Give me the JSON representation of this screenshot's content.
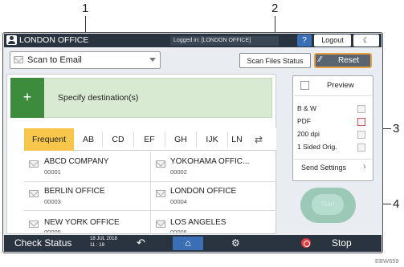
{
  "callouts": [
    "1",
    "2",
    "3",
    "4"
  ],
  "header": {
    "title": "LONDON OFFICE",
    "logged_in": "Logged in: [LONDON OFFICE]",
    "help": "?",
    "logout": "Logout",
    "moon_icon": "moon-icon"
  },
  "function_select": {
    "value": "Scan to Email",
    "icon": "envelope-icon"
  },
  "scan_files_status": "Scan Files Status",
  "reset": "Reset",
  "destination": {
    "plus": "+",
    "label": "Specify destination(s)"
  },
  "tabs": [
    {
      "label": "Frequent",
      "active": true
    },
    {
      "label": "AB",
      "active": false
    },
    {
      "label": "CD",
      "active": false
    },
    {
      "label": "EF",
      "active": false
    },
    {
      "label": "GH",
      "active": false
    },
    {
      "label": "IJK",
      "active": false
    },
    {
      "label": "LN",
      "active": false
    }
  ],
  "destinations": [
    {
      "name": "ABCD COMPANY",
      "number": "00001"
    },
    {
      "name": "YOKOHAMA OFFIC...",
      "number": "00002"
    },
    {
      "name": "BERLIN OFFICE",
      "number": "00003"
    },
    {
      "name": "LONDON OFFICE",
      "number": "00004"
    },
    {
      "name": "NEW YORK OFFICE",
      "number": "00005"
    },
    {
      "name": "LOS ANGELES",
      "number": "00006"
    }
  ],
  "side_panel": {
    "preview": "Preview",
    "settings": [
      "B & W",
      "PDF",
      "200 dpi",
      "1 Sided Orig."
    ],
    "send_settings": "Send Settings",
    "start": "Start"
  },
  "bottom_bar": {
    "check_status": "Check Status",
    "date": "18 JUL 2018",
    "time": "11 : 18",
    "stop": "Stop"
  },
  "code": "EBW659"
}
